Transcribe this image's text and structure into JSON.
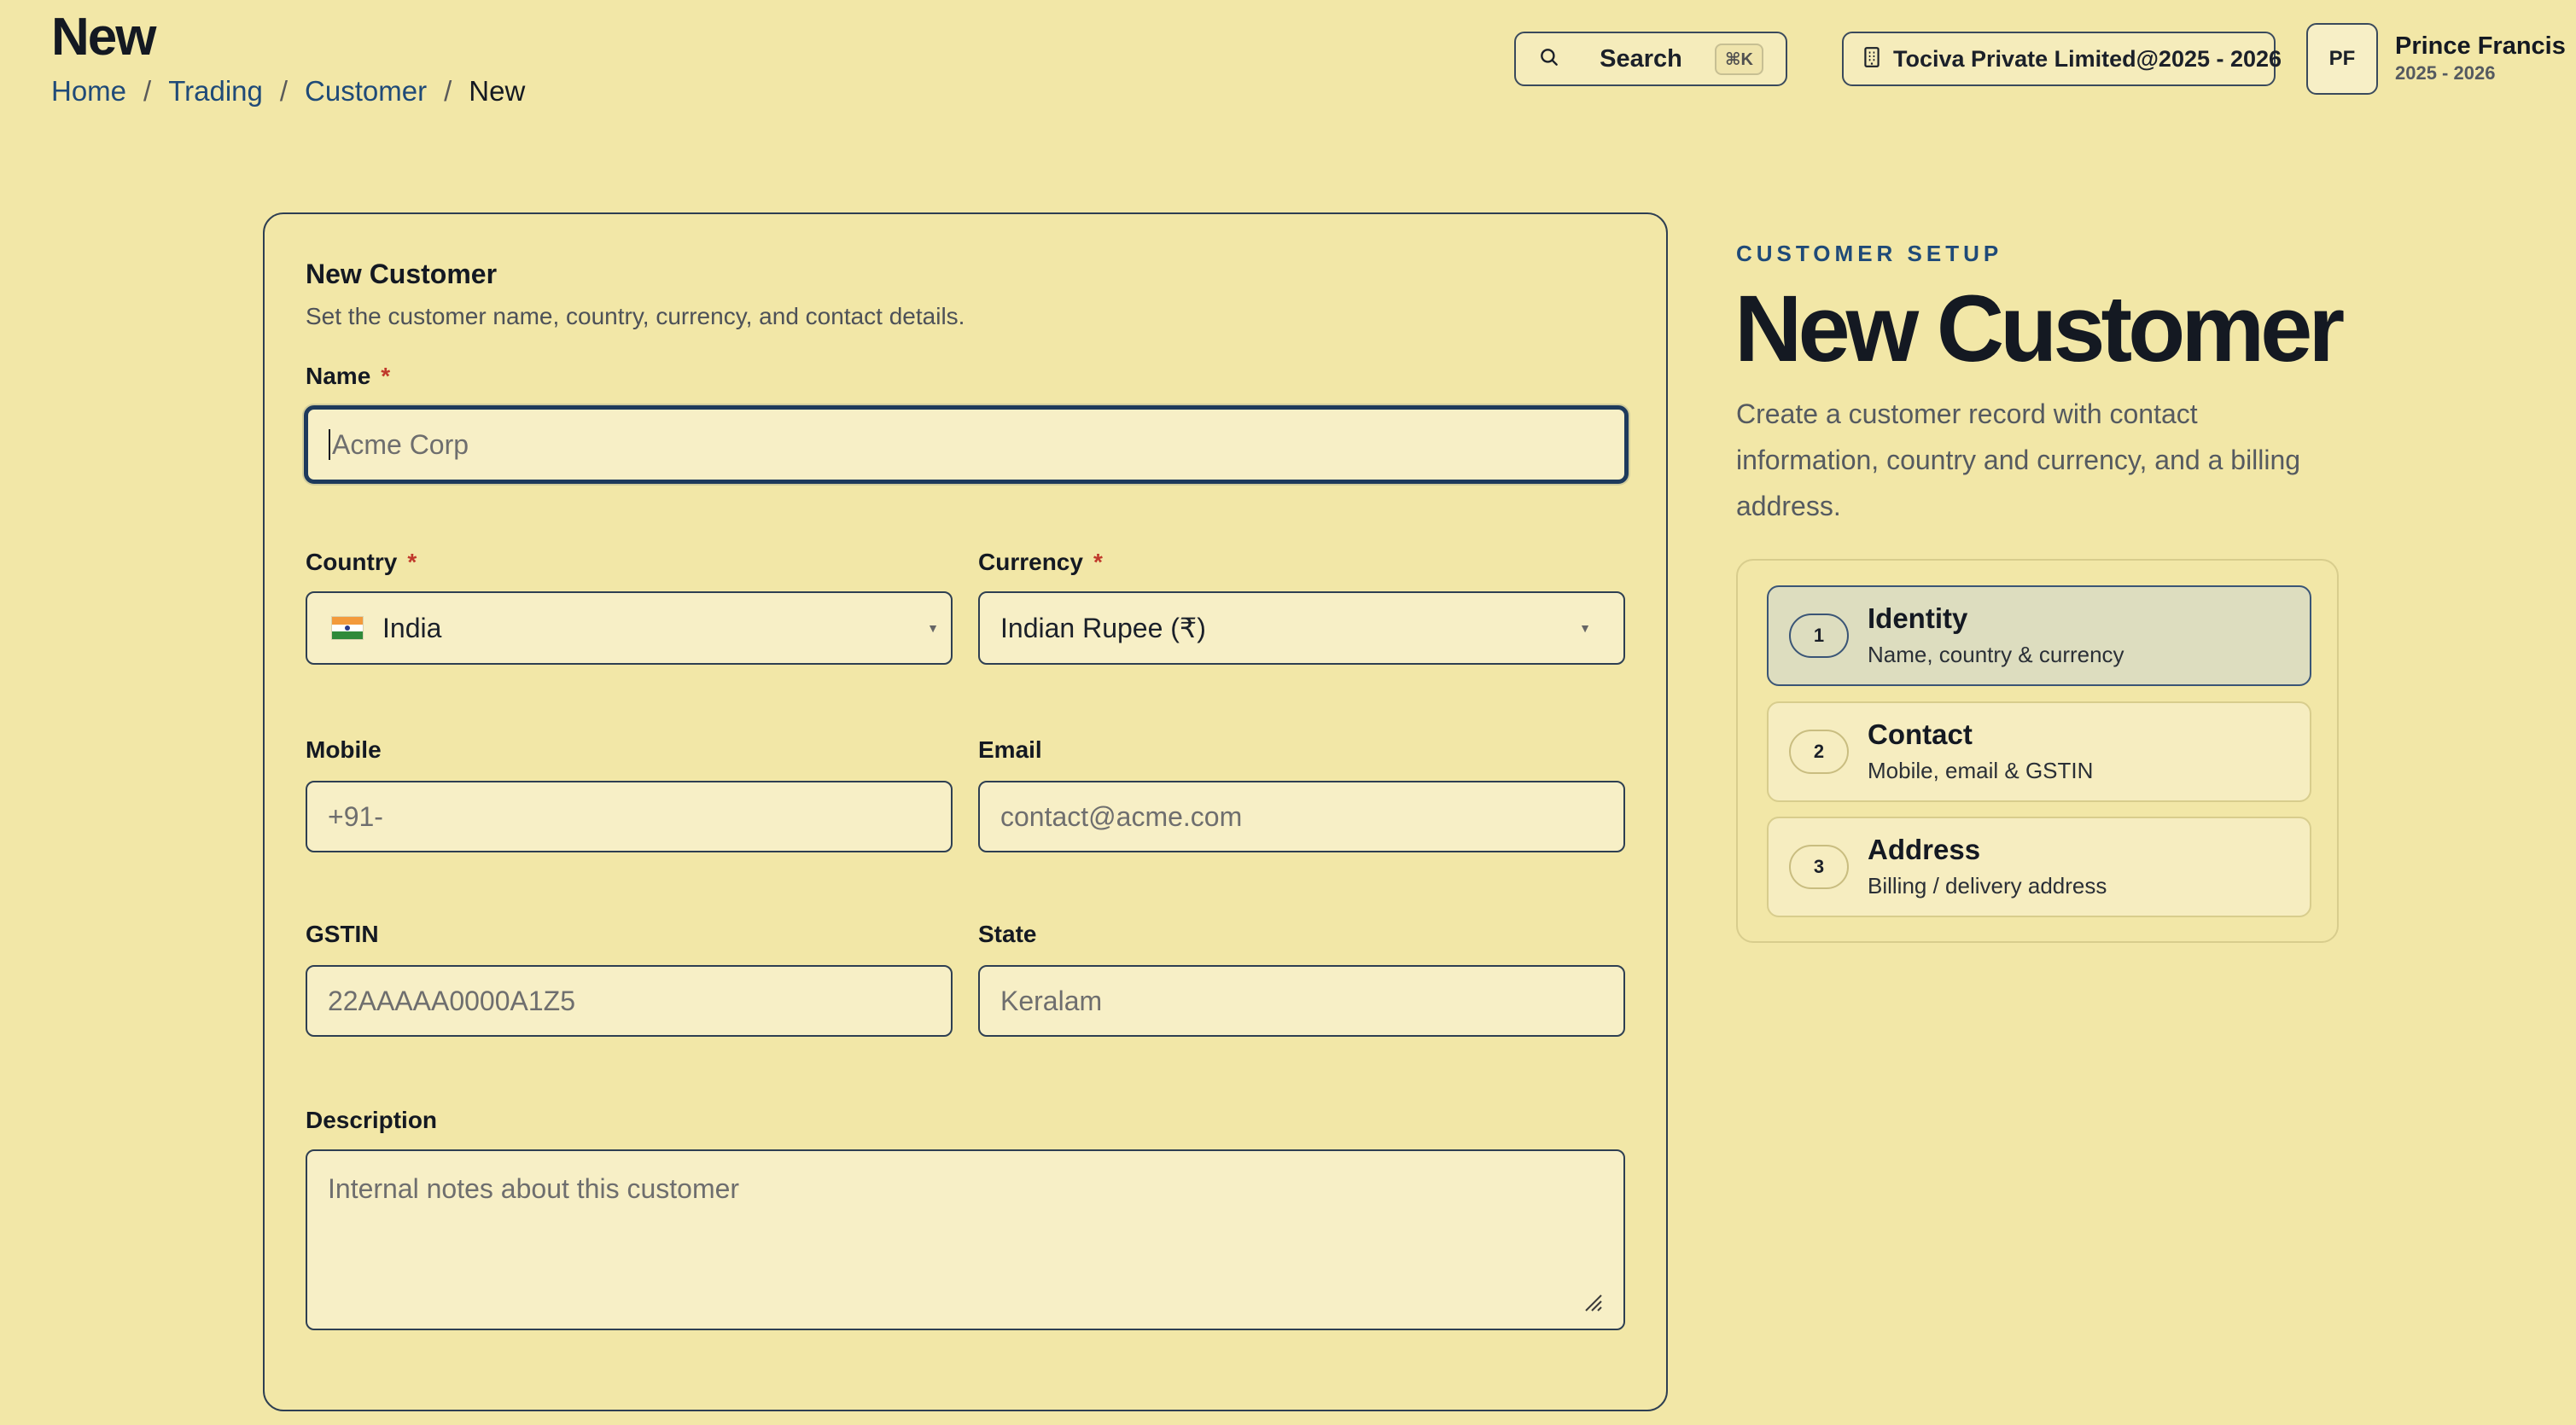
{
  "header": {
    "title": "New",
    "breadcrumb": [
      "Home",
      "Trading",
      "Customer",
      "New"
    ],
    "search": {
      "label": "Search",
      "shortcut": "⌘K"
    },
    "company": "Tociva Private Limited@2025 - 2026",
    "user": {
      "initials": "PF",
      "name": "Prince Francis",
      "period": "2025 - 2026"
    }
  },
  "form": {
    "title": "New Customer",
    "subtitle": "Set the customer name, country, currency, and contact details.",
    "name": {
      "label": "Name",
      "placeholder": "Acme Corp"
    },
    "country": {
      "label": "Country",
      "value": "India"
    },
    "currency": {
      "label": "Currency",
      "value": "Indian Rupee (₹)"
    },
    "mobile": {
      "label": "Mobile",
      "placeholder": "+91-"
    },
    "email": {
      "label": "Email",
      "placeholder": "contact@acme.com"
    },
    "gstin": {
      "label": "GSTIN",
      "placeholder": "22AAAAA0000A1Z5"
    },
    "state": {
      "label": "State",
      "placeholder": "Keralam"
    },
    "description": {
      "label": "Description",
      "placeholder": "Internal notes about this customer"
    },
    "required_mark": "*"
  },
  "side": {
    "eyebrow": "CUSTOMER SETUP",
    "title": "New Customer",
    "description": "Create a customer record with contact information, country and currency, and a billing address.",
    "steps": [
      {
        "num": "1",
        "title": "Identity",
        "sub": "Name, country & currency",
        "active": true
      },
      {
        "num": "2",
        "title": "Contact",
        "sub": "Mobile, email & GSTIN",
        "active": false
      },
      {
        "num": "3",
        "title": "Address",
        "sub": "Billing / delivery address",
        "active": false
      }
    ]
  },
  "colors": {
    "background": "#f2e7a7",
    "accent": "#1f4a78",
    "border": "#2e3f52",
    "required": "#c0392b"
  }
}
